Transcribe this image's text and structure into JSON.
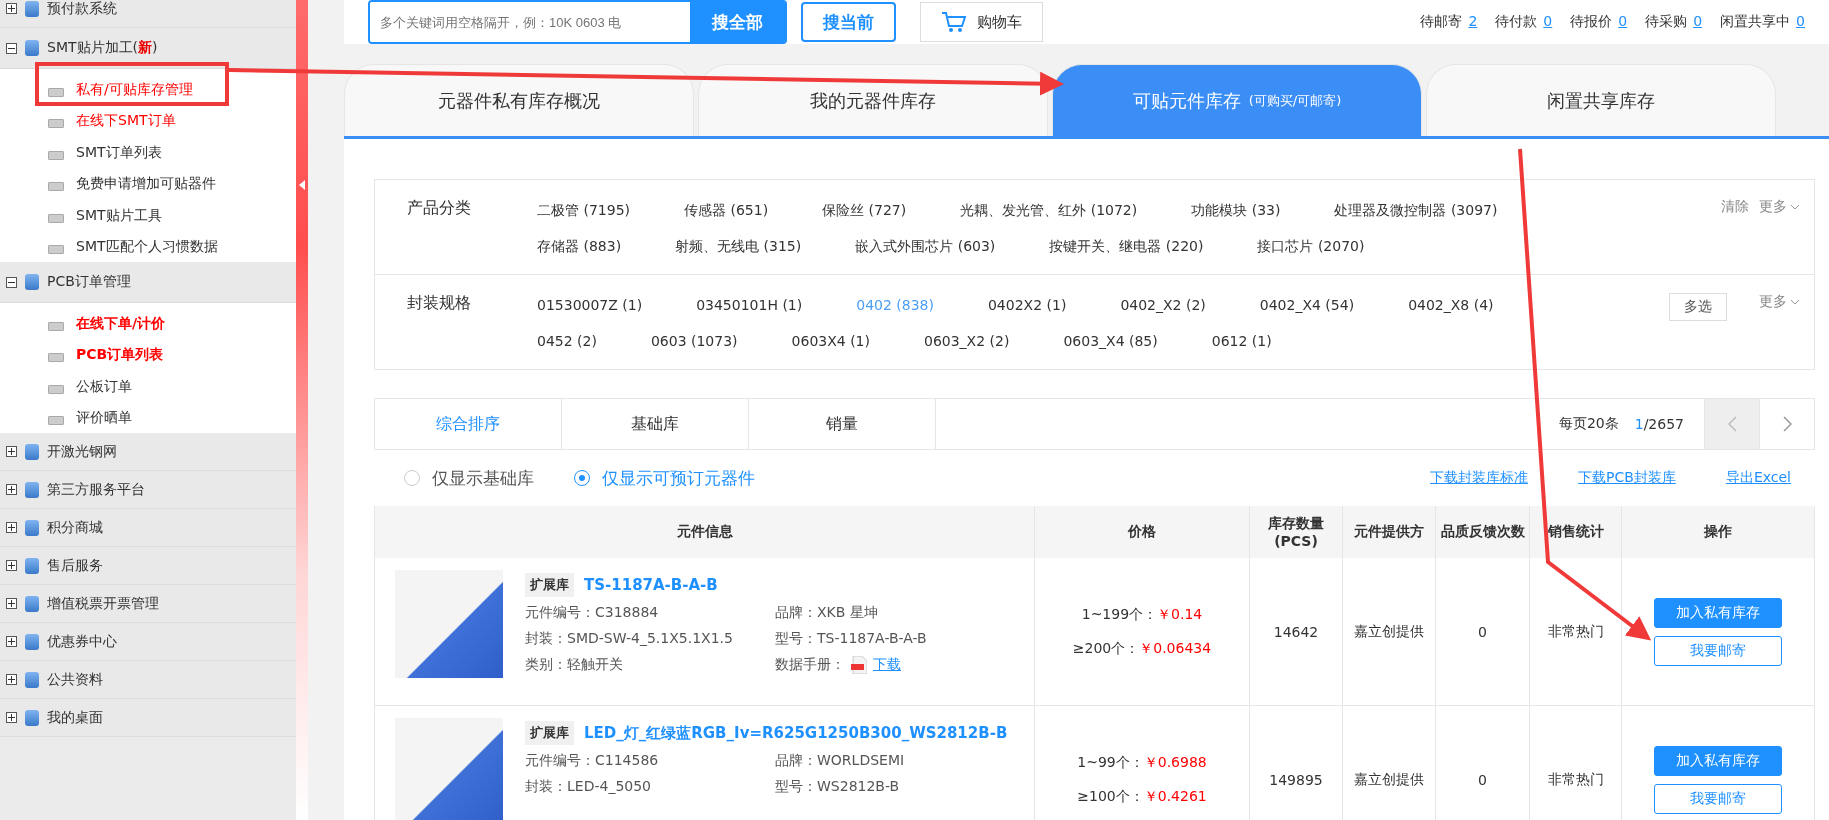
{
  "topbar": {
    "search_placeholder": "多个关键词用空格隔开，例：10K 0603 电",
    "buttons": [
      "搜全部",
      "搜当前"
    ],
    "cart": "购物车",
    "counters": [
      {
        "label": "待邮寄",
        "count": "2"
      },
      {
        "label": "待付款",
        "count": "0"
      },
      {
        "label": "待报价",
        "count": "0"
      },
      {
        "label": "待采购",
        "count": "0"
      },
      {
        "label": "闲置共享中",
        "count": "0"
      }
    ]
  },
  "sidebar": {
    "groups": [
      {
        "label": "预付款系统",
        "expanded": false
      },
      {
        "label": "SMT贴片加工(",
        "badge": "新",
        "label_end": ")",
        "expanded": true,
        "children": [
          {
            "label": "私有/可贴库存管理",
            "color": "#ff0000",
            "bold": false
          },
          {
            "label": "在线下SMT订单",
            "color": "#ff0000",
            "bold": false
          },
          {
            "label": "SMT订单列表",
            "color": "#333333",
            "bold": false
          },
          {
            "label": "免费申请增加可贴器件",
            "color": "#333333",
            "bold": false
          },
          {
            "label": "SMT贴片工具",
            "color": "#333333",
            "bold": false
          },
          {
            "label": "SMT匹配个人习惯数据",
            "color": "#333333",
            "bold": false
          }
        ]
      },
      {
        "label": "PCB订单管理",
        "expanded": true,
        "children": [
          {
            "label": "在线下单/计价",
            "color": "#ff0000",
            "bold": true
          },
          {
            "label": "PCB订单列表",
            "color": "#ff0000",
            "bold": true
          },
          {
            "label": "公板订单",
            "color": "#333333",
            "bold": false
          },
          {
            "label": "评价晒单",
            "color": "#333333",
            "bold": false
          }
        ]
      },
      {
        "label": "开激光钢网",
        "expanded": false
      },
      {
        "label": "第三方服务平台",
        "expanded": false
      },
      {
        "label": "积分商城",
        "expanded": false
      },
      {
        "label": "售后服务",
        "expanded": false
      },
      {
        "label": "增值税票开票管理",
        "expanded": false
      },
      {
        "label": "优惠券中心",
        "expanded": false
      },
      {
        "label": "公共资料",
        "expanded": false
      },
      {
        "label": "我的桌面",
        "expanded": false
      }
    ]
  },
  "tabs": [
    {
      "label": "元器件私有库存概况",
      "selected": false
    },
    {
      "label": "我的元器件库存",
      "selected": false
    },
    {
      "label": "可贴元件库存",
      "sub": "(可购买/可邮寄)",
      "selected": true
    },
    {
      "label": "闲置共享库存",
      "selected": false
    }
  ],
  "filters": [
    {
      "label": "产品分类",
      "options": [
        {
          "text": "二极管 (7195)",
          "selected": false
        },
        {
          "text": "传感器 (651)",
          "selected": false
        },
        {
          "text": "保险丝 (727)",
          "selected": false
        },
        {
          "text": "光耦、发光管、红外 (1072)",
          "selected": false
        },
        {
          "text": "功能模块 (33)",
          "selected": false
        },
        {
          "text": "处理器及微控制器 (3097)",
          "selected": false
        },
        {
          "text": "存储器 (883)",
          "selected": false
        },
        {
          "text": "射频、无线电 (315)",
          "selected": false
        },
        {
          "text": "嵌入式外围芯片 (603)",
          "selected": false
        },
        {
          "text": "按键开关、继电器 (220)",
          "selected": false
        },
        {
          "text": "接口芯片 (2070)",
          "selected": false
        }
      ],
      "clear": "清除",
      "more": "更多"
    },
    {
      "label": "封装规格",
      "options": [
        {
          "text": "01530007Z (1)",
          "selected": false
        },
        {
          "text": "03450101H (1)",
          "selected": false
        },
        {
          "text": "0402 (838)",
          "selected": true
        },
        {
          "text": "0402X2 (1)",
          "selected": false
        },
        {
          "text": "0402_X2 (2)",
          "selected": false
        },
        {
          "text": "0402_X4 (54)",
          "selected": false
        },
        {
          "text": "0402_X8 (4)",
          "selected": false
        },
        {
          "text": "0452 (2)",
          "selected": false
        },
        {
          "text": "0603 (1073)",
          "selected": false
        },
        {
          "text": "0603X4 (1)",
          "selected": false
        },
        {
          "text": "0603_X2 (2)",
          "selected": false
        },
        {
          "text": "0603_X4 (85)",
          "selected": false
        },
        {
          "text": "0612 (1)",
          "selected": false
        }
      ],
      "multi": "多选",
      "more": "更多"
    }
  ],
  "sort": {
    "tabs": [
      {
        "label": "综合排序",
        "selected": true
      },
      {
        "label": "基础库",
        "selected": false
      },
      {
        "label": "销量",
        "selected": false
      }
    ],
    "per_page": "每页20条",
    "page": "1",
    "total": "/2657",
    "prev_disabled": true
  },
  "radios": [
    {
      "label": "仅显示基础库",
      "selected": false
    },
    {
      "label": "仅显示可预订元器件",
      "selected": true
    }
  ],
  "links": [
    "下载封装库标准",
    "下载PCB封装库",
    "导出Excel"
  ],
  "table": {
    "columns": [
      "元件信息",
      "价格",
      "库存数量(PCS)",
      "元件提供方",
      "品质反馈次数",
      "销售统计",
      "操作"
    ],
    "rows": [
      {
        "tag": "扩展库",
        "title": "TS-1187A-B-A-B",
        "fields": [
          "元件编号：C318884",
          "品牌：XKB 星坤",
          "封装：SMD-SW-4_5.1X5.1X1.5",
          "型号：TS-1187A-B-A-B",
          "类别：轻触开关"
        ],
        "datasheet_label": "数据手册：",
        "datasheet_link": "下载",
        "prices": [
          {
            "qty": "1~199个：",
            "price": "￥0.14"
          },
          {
            "qty": "≥200个：",
            "price": "￥0.06434"
          }
        ],
        "stock": "14642",
        "supplier": "嘉立创提供",
        "feedback": "0",
        "sales": "非常热门",
        "actions": [
          "加入私有库存",
          "我要邮寄"
        ]
      },
      {
        "tag": "扩展库",
        "title": "LED_灯_红绿蓝RGB_Iv=R625G1250B300_WS2812B-B",
        "fields": [
          "元件编号：C114586",
          "品牌：WORLDSEMI",
          "封装：LED-4_5050",
          "型号：WS2812B-B"
        ],
        "prices": [
          {
            "qty": "1~99个：",
            "price": "￥0.6988"
          },
          {
            "qty": "≥100个：",
            "price": "￥0.4261"
          }
        ],
        "stock": "149895",
        "supplier": "嘉立创提供",
        "feedback": "0",
        "sales": "非常热门",
        "actions": [
          "加入私有库存",
          "我要邮寄"
        ]
      }
    ]
  }
}
